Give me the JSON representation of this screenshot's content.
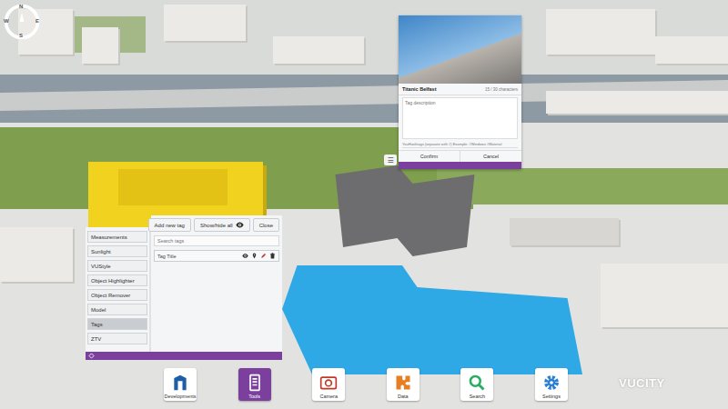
{
  "compass": {
    "labels": [
      {
        "text": "N"
      },
      {
        "text": "E"
      },
      {
        "text": "S"
      },
      {
        "text": "W"
      }
    ]
  },
  "tag_popup": {
    "title": "Titanic Belfast",
    "counter": "15 / 30 characters",
    "description_placeholder": "Tag description",
    "hashtags_placeholder": "YouHashtags (separate with #) Example: #Windows #Material",
    "buttons": [
      "Confirm",
      "Cancel"
    ],
    "menu_icon": "☰"
  },
  "tools_panel": {
    "sidebar": [
      {
        "label": "Measurements",
        "selected": false
      },
      {
        "label": "Sunlight",
        "selected": false
      },
      {
        "label": "VUStyle",
        "selected": false
      },
      {
        "label": "Object Highlighter",
        "selected": false
      },
      {
        "label": "Object Remover",
        "selected": false
      },
      {
        "label": "Model",
        "selected": false
      },
      {
        "label": "Tags",
        "selected": true
      },
      {
        "label": "ZTV",
        "selected": false
      }
    ],
    "buttons": [
      "Add new tag",
      "Show/hide all",
      "Close"
    ],
    "search_placeholder": "Search tags",
    "tags": [
      {
        "title": "Tag Title"
      }
    ]
  },
  "toolbar": [
    {
      "label": "Developments",
      "selected": false,
      "kind": "developments"
    },
    {
      "label": "Tools",
      "selected": true,
      "kind": "tools"
    },
    {
      "label": "Camera",
      "selected": false,
      "kind": "camera"
    },
    {
      "label": "Data",
      "selected": false,
      "kind": "data"
    },
    {
      "label": "Search",
      "selected": false,
      "kind": "search"
    },
    {
      "label": "Settings",
      "selected": false,
      "kind": "settings"
    }
  ],
  "logo": "VUCITY"
}
